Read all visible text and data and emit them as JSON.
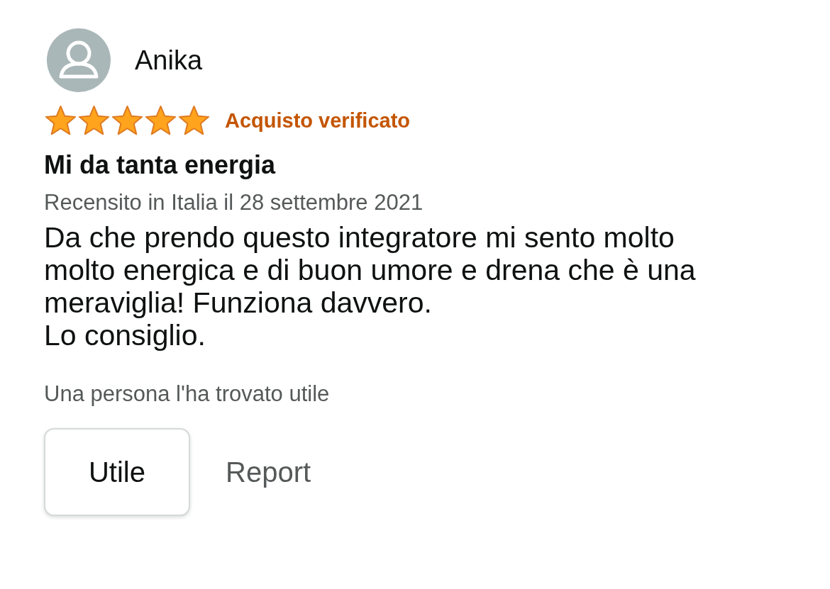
{
  "review": {
    "author": "Anika",
    "stars": 5,
    "badge": "Acquisto verificato",
    "title": "Mi da tanta energia",
    "date": "Recensito in Italia il 28 settembre 2021",
    "body": [
      "Da che prendo questo integratore mi sento molto molto energica e di buon umore e drena che è una meraviglia! Funziona davvero.",
      "Lo consiglio."
    ],
    "helpful_count": "Una persona l'ha trovato utile",
    "buttons": {
      "helpful": "Utile",
      "report": "Report"
    }
  }
}
